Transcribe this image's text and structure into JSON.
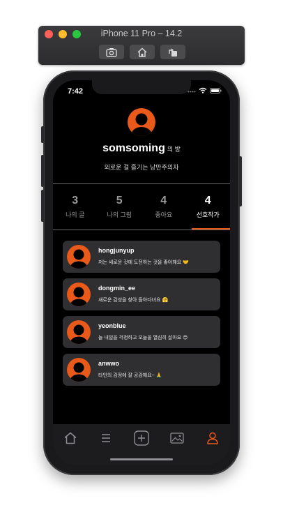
{
  "simulator": {
    "title": "iPhone 11 Pro – 14.2",
    "buttons": [
      "screenshot-icon",
      "home-icon",
      "rotate-icon"
    ]
  },
  "status_bar": {
    "time": "7:42"
  },
  "profile": {
    "name": "somsoming",
    "name_suffix": "의 방",
    "bio": "외로운 걸 즐기는 낭만주의자"
  },
  "tabs": [
    {
      "count": "3",
      "label": "나의 글"
    },
    {
      "count": "5",
      "label": "나의 그림"
    },
    {
      "count": "4",
      "label": "좋아요"
    },
    {
      "count": "4",
      "label": "선호작가",
      "active": true
    }
  ],
  "favorites": [
    {
      "username": "hongjunyup",
      "message": "저는 새로운 것에 도전하는 것을 좋아해요 🤝"
    },
    {
      "username": "dongmin_ee",
      "message": "새로운 감성을 찾아 돌아다녀요 🤗"
    },
    {
      "username": "yeonblue",
      "message": "늘 내일을 걱정하고 오늘을 열심히 살아요 😊"
    },
    {
      "username": "anwwo",
      "message": "타인의 감정에 잘 공감해요~ 🙏"
    }
  ],
  "bottom_nav": [
    "home-icon",
    "menu-icon",
    "add-icon",
    "gallery-icon",
    "profile-icon"
  ],
  "colors": {
    "accent": "#e8591a",
    "background": "#000000",
    "card": "#2f2f31",
    "nav": "#1c1c1e"
  }
}
